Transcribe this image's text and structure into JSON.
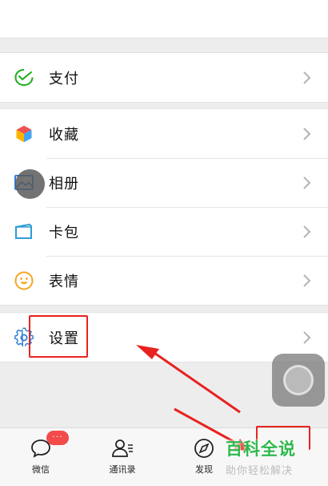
{
  "menu": {
    "pay": {
      "label": "支付",
      "icon": "pay-icon",
      "color": "#1aad19"
    },
    "group2": [
      {
        "id": "favorites",
        "label": "收藏",
        "icon": "favorites-cube-icon"
      },
      {
        "id": "album",
        "label": "相册",
        "icon": "album-icon"
      },
      {
        "id": "cards",
        "label": "卡包",
        "icon": "card-wallet-icon"
      },
      {
        "id": "stickers",
        "label": "表情",
        "icon": "smiley-icon"
      }
    ],
    "settings": {
      "label": "设置",
      "icon": "gear-icon"
    }
  },
  "tabbar": {
    "items": [
      {
        "id": "chats",
        "label": "微信",
        "icon": "chat-bubble-icon"
      },
      {
        "id": "contacts",
        "label": "通讯录",
        "icon": "contacts-icon"
      },
      {
        "id": "discover",
        "label": "发现",
        "icon": "compass-icon"
      }
    ],
    "chats_badge": "···"
  },
  "watermark": {
    "title": "百科全说",
    "subtitle": "助你轻松解决"
  },
  "colors": {
    "annotation": "#e8231f",
    "wechat_green": "#1aad19",
    "watermark_green": "#2eb84b"
  }
}
